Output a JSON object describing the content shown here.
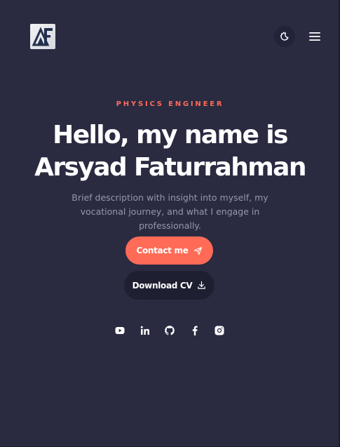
{
  "header": {
    "logo_text": "AF",
    "theme_toggle_icon": "moon-sun-icon",
    "menu_icon": "hamburger-menu-icon"
  },
  "hero": {
    "eyebrow": "PHYSICS ENGINEER",
    "headline_line1": "Hello, my name is",
    "headline_line2": "Arsyad Faturrahman",
    "description": "Brief description with insight into myself, my vocational journey, and what I engage in professionally.",
    "contact_label": "Contact me",
    "contact_icon": "paper-plane-icon",
    "cv_label": "Download CV",
    "cv_icon": "download-icon"
  },
  "socials": [
    {
      "icon": "youtube-icon"
    },
    {
      "icon": "linkedin-icon"
    },
    {
      "icon": "github-icon"
    },
    {
      "icon": "facebook-icon"
    },
    {
      "icon": "instagram-icon"
    }
  ],
  "colors": {
    "background": "#2a2b41",
    "accent": "#ff6b57",
    "muted_text": "#9597b1",
    "dark_button": "#1e1f31"
  }
}
